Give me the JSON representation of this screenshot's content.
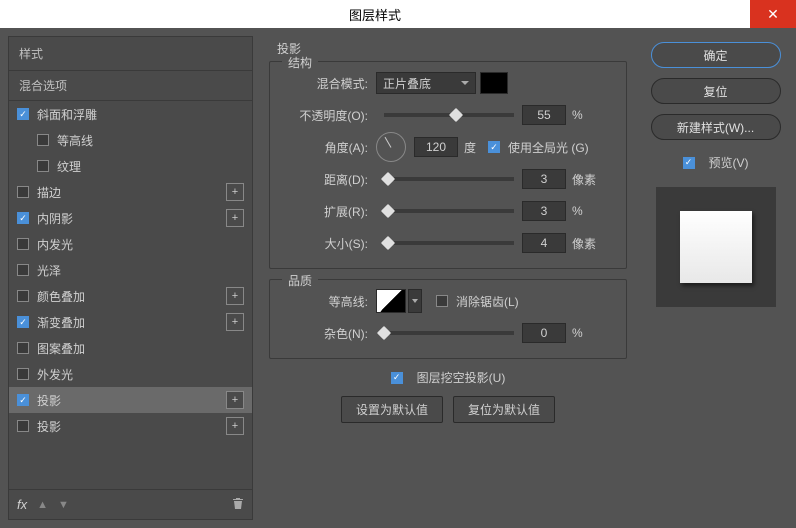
{
  "window": {
    "title": "图层样式",
    "close": "✕"
  },
  "left": {
    "header": "样式",
    "blend_options": "混合选项",
    "items": [
      {
        "label": "斜面和浮雕",
        "checked": true,
        "plus": false,
        "indent": false
      },
      {
        "label": "等高线",
        "checked": false,
        "plus": false,
        "indent": true
      },
      {
        "label": "纹理",
        "checked": false,
        "plus": false,
        "indent": true
      },
      {
        "label": "描边",
        "checked": false,
        "plus": true,
        "indent": false
      },
      {
        "label": "内阴影",
        "checked": true,
        "plus": true,
        "indent": false
      },
      {
        "label": "内发光",
        "checked": false,
        "plus": false,
        "indent": false
      },
      {
        "label": "光泽",
        "checked": false,
        "plus": false,
        "indent": false
      },
      {
        "label": "颜色叠加",
        "checked": false,
        "plus": true,
        "indent": false
      },
      {
        "label": "渐变叠加",
        "checked": true,
        "plus": true,
        "indent": false
      },
      {
        "label": "图案叠加",
        "checked": false,
        "plus": false,
        "indent": false
      },
      {
        "label": "外发光",
        "checked": false,
        "plus": false,
        "indent": false
      },
      {
        "label": "投影",
        "checked": true,
        "plus": true,
        "indent": false,
        "selected": true
      },
      {
        "label": "投影",
        "checked": false,
        "plus": true,
        "indent": false
      }
    ],
    "footer": {
      "fx": "fx",
      "plus": "+"
    }
  },
  "center": {
    "title": "投影",
    "structure": {
      "legend": "结构",
      "blend_mode_label": "混合模式:",
      "blend_mode_value": "正片叠底",
      "opacity_label": "不透明度(O):",
      "opacity_value": "55",
      "opacity_unit": "%",
      "angle_label": "角度(A):",
      "angle_value": "120",
      "angle_unit": "度",
      "global_light": "使用全局光 (G)",
      "distance_label": "距离(D):",
      "distance_value": "3",
      "distance_unit": "像素",
      "spread_label": "扩展(R):",
      "spread_value": "3",
      "spread_unit": "%",
      "size_label": "大小(S):",
      "size_value": "4",
      "size_unit": "像素"
    },
    "quality": {
      "legend": "品质",
      "contour_label": "等高线:",
      "antialias": "消除锯齿(L)",
      "noise_label": "杂色(N):",
      "noise_value": "0",
      "noise_unit": "%"
    },
    "knockout": "图层挖空投影(U)",
    "reset_default": "设置为默认值",
    "restore_default": "复位为默认值"
  },
  "right": {
    "ok": "确定",
    "cancel": "复位",
    "new_style": "新建样式(W)...",
    "preview": "预览(V)"
  }
}
